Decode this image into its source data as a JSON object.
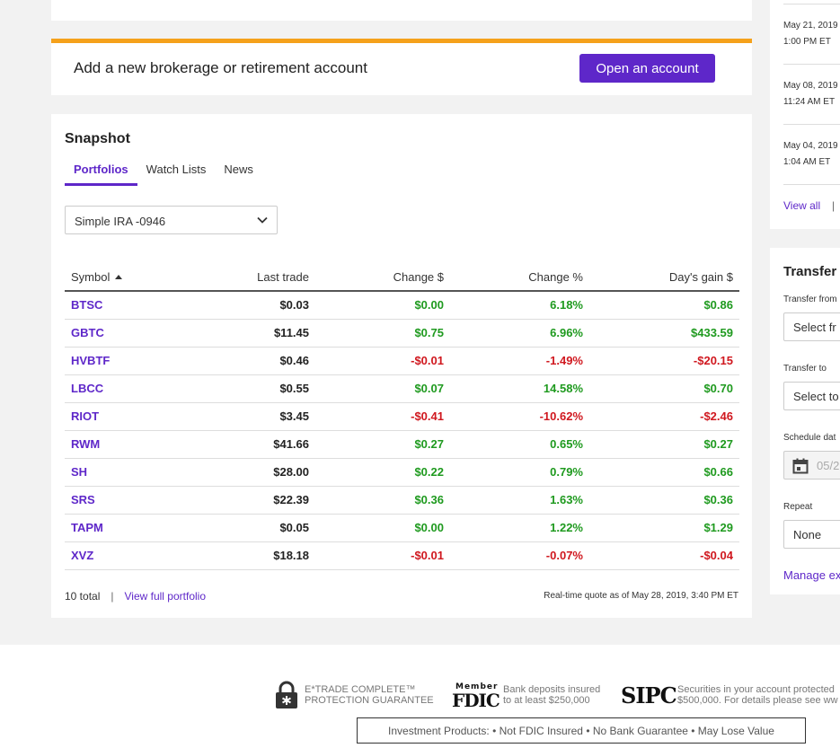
{
  "promo": {
    "title": "Add a new brokerage or retirement account",
    "button_label": "Open an account",
    "accent_color": "#f5a11b"
  },
  "snapshot": {
    "heading": "Snapshot",
    "tabs": [
      "Portfolios",
      "Watch Lists",
      "News"
    ],
    "active_tab": "Portfolios",
    "account_select": "Simple IRA -0946",
    "columns": [
      "Symbol",
      "Last trade",
      "Change $",
      "Change %",
      "Day's gain $"
    ],
    "sorted_by": "Symbol",
    "rows": [
      {
        "symbol": "BTSC",
        "last_trade": "$0.03",
        "change": "$0.00",
        "change_pct": "6.18%",
        "days_gain": "$0.86",
        "dir": "up"
      },
      {
        "symbol": "GBTC",
        "last_trade": "$11.45",
        "change": "$0.75",
        "change_pct": "6.96%",
        "days_gain": "$433.59",
        "dir": "up"
      },
      {
        "symbol": "HVBTF",
        "last_trade": "$0.46",
        "change": "-$0.01",
        "change_pct": "-1.49%",
        "days_gain": "-$20.15",
        "dir": "down"
      },
      {
        "symbol": "LBCC",
        "last_trade": "$0.55",
        "change": "$0.07",
        "change_pct": "14.58%",
        "days_gain": "$0.70",
        "dir": "up"
      },
      {
        "symbol": "RIOT",
        "last_trade": "$3.45",
        "change": "-$0.41",
        "change_pct": "-10.62%",
        "days_gain": "-$2.46",
        "dir": "down"
      },
      {
        "symbol": "RWM",
        "last_trade": "$41.66",
        "change": "$0.27",
        "change_pct": "0.65%",
        "days_gain": "$0.27",
        "dir": "up"
      },
      {
        "symbol": "SH",
        "last_trade": "$28.00",
        "change": "$0.22",
        "change_pct": "0.79%",
        "days_gain": "$0.66",
        "dir": "up"
      },
      {
        "symbol": "SRS",
        "last_trade": "$22.39",
        "change": "$0.36",
        "change_pct": "1.63%",
        "days_gain": "$0.36",
        "dir": "up"
      },
      {
        "symbol": "TAPM",
        "last_trade": "$0.05",
        "change": "$0.00",
        "change_pct": "1.22%",
        "days_gain": "$1.29",
        "dir": "up"
      },
      {
        "symbol": "XVZ",
        "last_trade": "$18.18",
        "change": "-$0.01",
        "change_pct": "-0.07%",
        "days_gain": "-$0.04",
        "dir": "down"
      }
    ],
    "total_label": "10 total",
    "separator": "|",
    "view_full_portfolio": "View full portfolio",
    "quote_time": "Real-time quote as of May 28, 2019, 3:40 PM ET"
  },
  "activity": {
    "items": [
      {
        "date": "May 21, 2019",
        "time": "1:00 PM ET"
      },
      {
        "date": "May 08, 2019",
        "time": "11:24 AM ET"
      },
      {
        "date": "May 04, 2019",
        "time": "1:04 AM ET"
      }
    ],
    "view_all": "View all",
    "separator": "|"
  },
  "transfer": {
    "title": "Transfer",
    "from_label": "Transfer from",
    "from_placeholder": "Select fr",
    "to_label": "Transfer to",
    "to_placeholder": "Select to",
    "date_label": "Schedule dat",
    "date_value": "05/2",
    "repeat_label": "Repeat",
    "repeat_value": "None",
    "manage_link": "Manage ex"
  },
  "footer": {
    "protection_line1": "E*TRADE COMPLETE™",
    "protection_line2": "PROTECTION GUARANTEE",
    "fdic_line1": "Bank deposits insured",
    "fdic_line2": "to at least $250,000",
    "fdic_logo_top": "Member",
    "fdic_logo_main": "FDIC",
    "sipc_logo": "SIPC",
    "sipc_line1": "Securities in your account protected",
    "sipc_line2": "$500,000. For details please see ww",
    "disclaimer": "Investment Products:  • Not FDIC Insured  • No Bank Guarantee  • May Lose Value"
  },
  "colors": {
    "brand_purple": "#5e27c9",
    "gain_green": "#1f9a1f",
    "loss_red": "#d0181f"
  }
}
